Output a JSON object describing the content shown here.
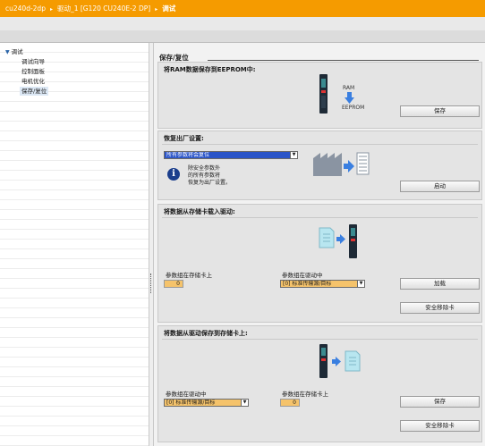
{
  "breadcrumb": {
    "items": [
      "cu240d-2dp",
      "驱动_1 [G120 CU240E-2 DP]",
      "调试"
    ],
    "separator": "▸"
  },
  "nav": {
    "root_label": "调试",
    "items": [
      {
        "label": "调试向导"
      },
      {
        "label": "控制面板"
      },
      {
        "label": "电机优化"
      },
      {
        "label": "保存/复位"
      }
    ]
  },
  "page": {
    "title": "保存/复位"
  },
  "sections": {
    "ram_to_eeprom": {
      "title": "将RAM数据保存到EEPROM中:",
      "diagram_labels": {
        "ram": "RAM",
        "eeprom": "EEPROM"
      },
      "button_label": "保存"
    },
    "factory_reset": {
      "title": "恢复出厂设置:",
      "dropdown_value": "所有参数将会复位",
      "info_text": "除安全参数外\n的所有参数将\n恢复为出厂设置。",
      "button_label": "启动"
    },
    "load_from_card": {
      "title": "将数据从存储卡载入驱动:",
      "left_label": "参数组在存储卡上",
      "left_value": "0",
      "right_label": "参数组在驱动中",
      "right_value": "[0] 标准传输源/目标",
      "button_load": "加载",
      "button_remove": "安全移除卡"
    },
    "save_to_card": {
      "title": "将数据从驱动保存到存储卡上:",
      "left_label": "参数组在驱动中",
      "left_value": "[0] 标准传输源/目标",
      "right_label": "参数组在存储卡上",
      "right_value": "0",
      "button_save": "保存",
      "button_remove": "安全移除卡"
    }
  },
  "colors": {
    "titlebar": "#f59b00",
    "accent_blue": "#2b55c8",
    "field_orange": "#f5c36b",
    "arrow_blue": "#3a7fe0"
  },
  "icons": [
    "info-icon",
    "drive-unit-icon",
    "factory-icon",
    "document-icon",
    "memory-card-icon",
    "arrow-icon",
    "dropdown-arrow-icon",
    "nav-expand-arrow-icon"
  ]
}
